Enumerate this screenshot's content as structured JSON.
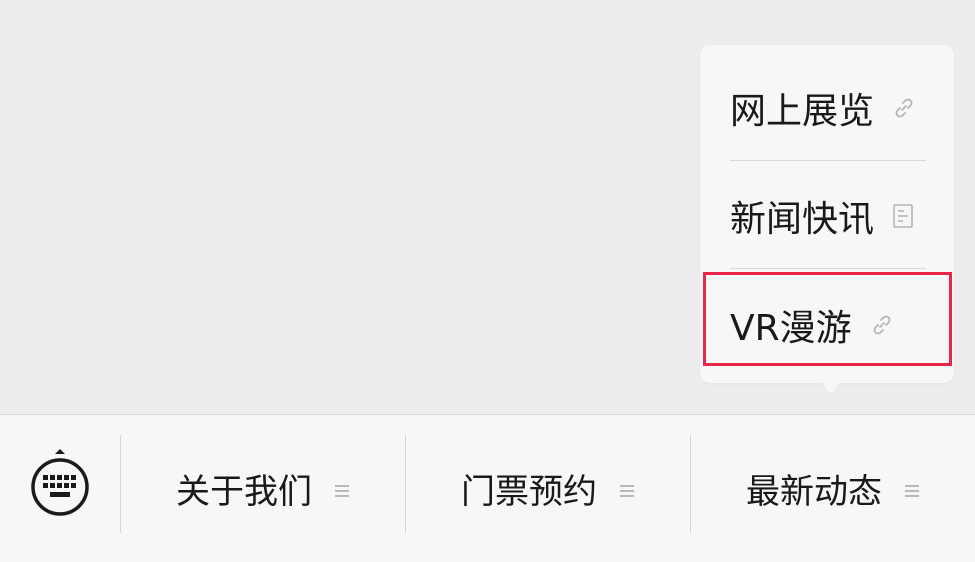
{
  "submenu": {
    "items": [
      {
        "label": "网上展览",
        "icon": "link-icon"
      },
      {
        "label": "新闻快讯",
        "icon": "article-icon"
      },
      {
        "label": "VR漫游",
        "icon": "link-icon"
      }
    ],
    "highlight_color": "#e8264a"
  },
  "bottom_menu": {
    "keyboard_icon": "keyboard-icon",
    "tabs": [
      {
        "label": "关于我们",
        "icon": "menu-lines-icon"
      },
      {
        "label": "门票预约",
        "icon": "menu-lines-icon"
      },
      {
        "label": "最新动态",
        "icon": "menu-lines-icon"
      }
    ]
  }
}
